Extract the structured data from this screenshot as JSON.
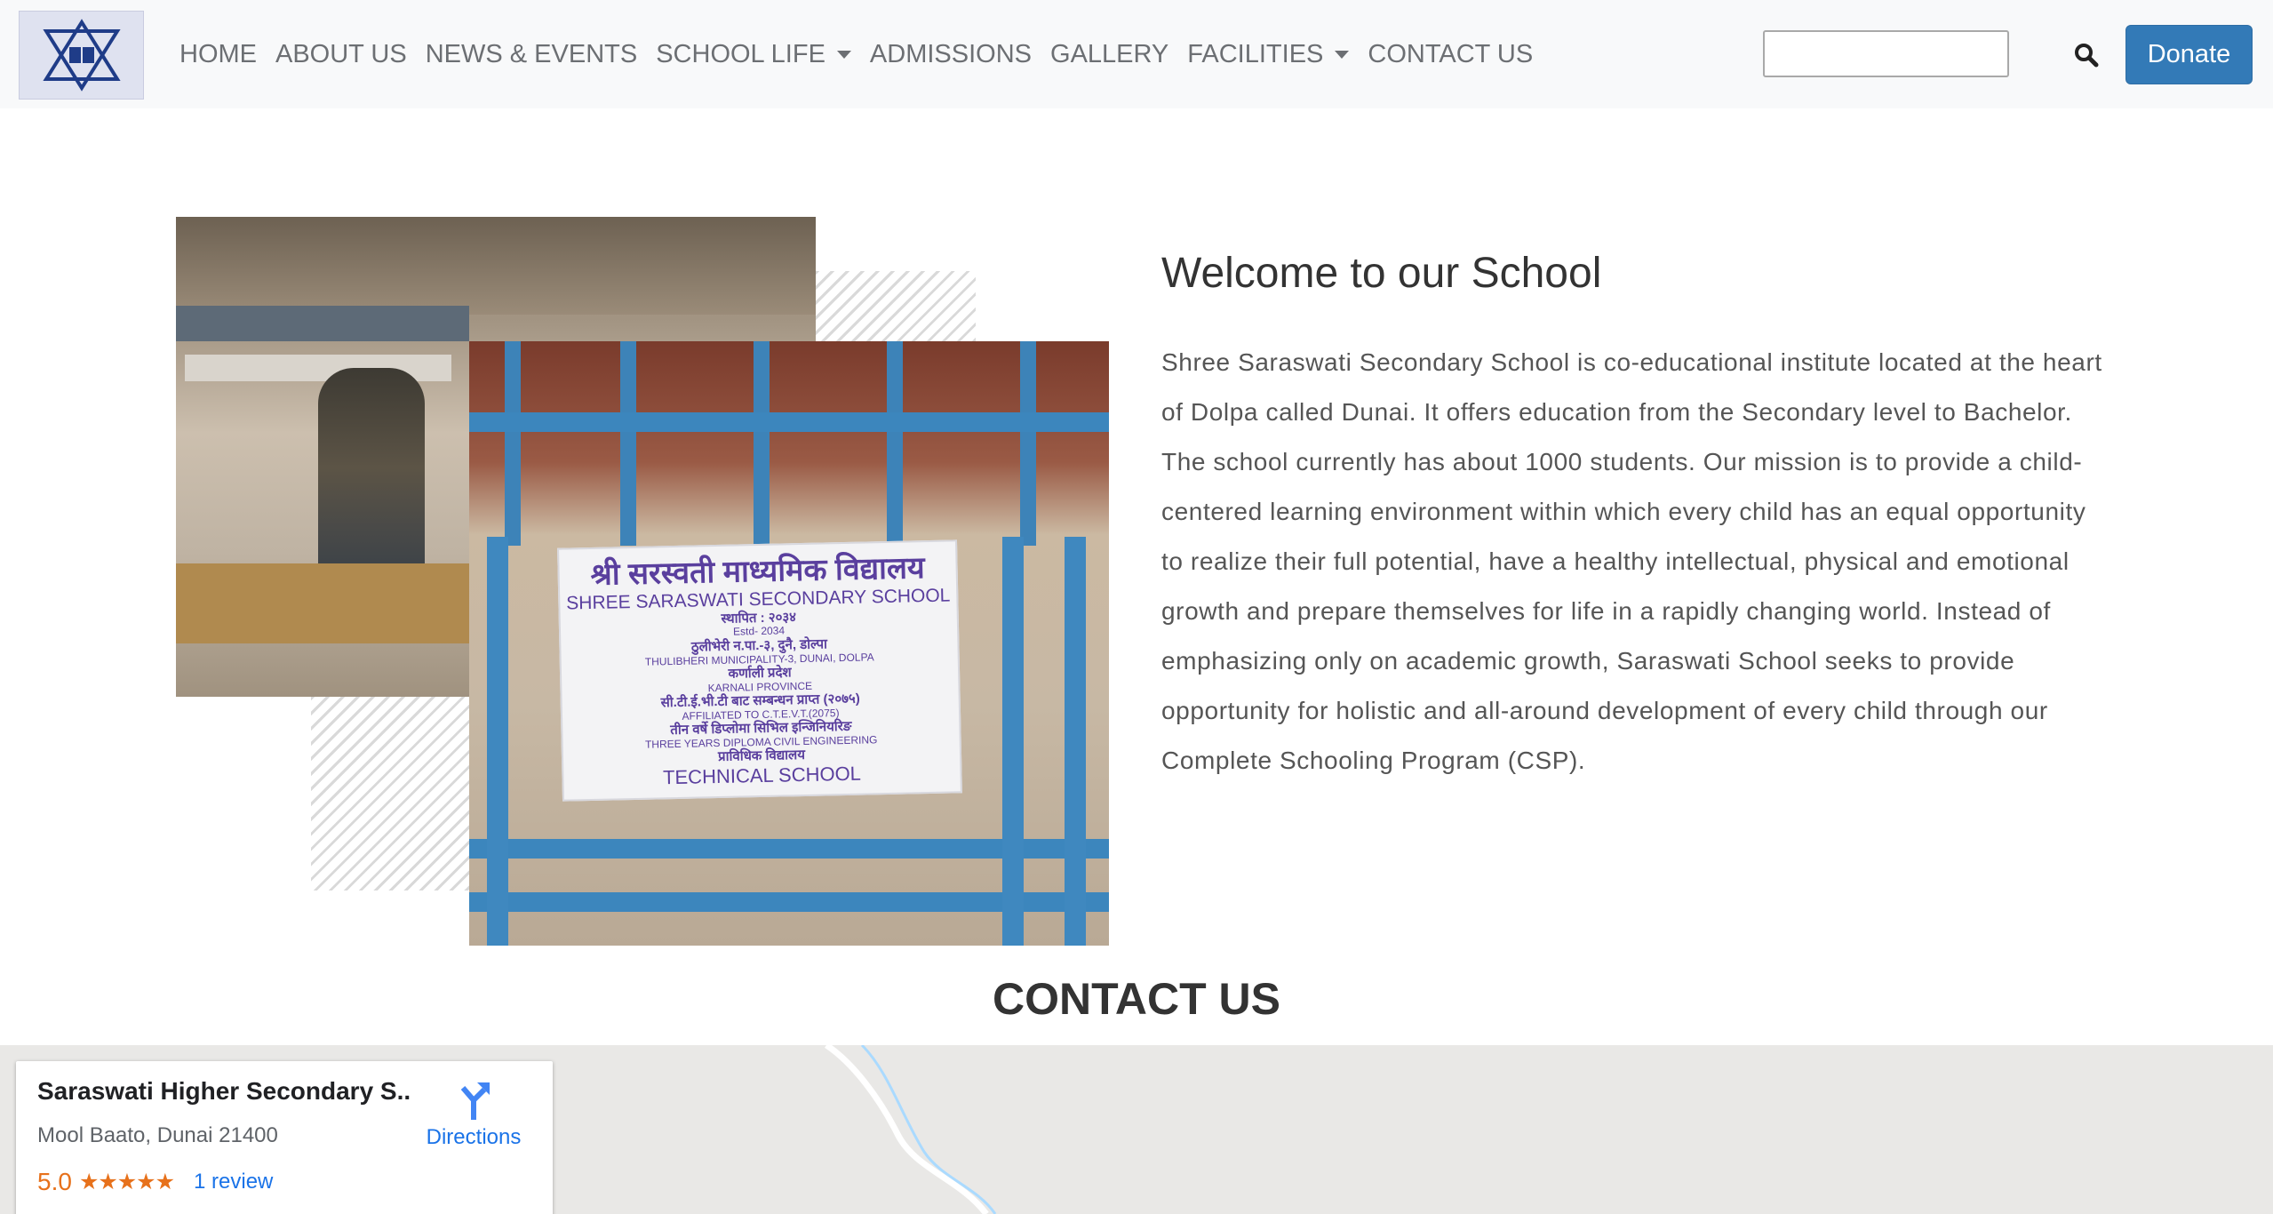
{
  "navbar": {
    "links": [
      {
        "label": "HOME"
      },
      {
        "label": "ABOUT US"
      },
      {
        "label": "NEWS & EVENTS"
      },
      {
        "label": "SCHOOL LIFE"
      },
      {
        "label": "ADMISSIONS"
      },
      {
        "label": "GALLERY"
      },
      {
        "label": "FACILITIES"
      },
      {
        "label": "CONTACT US"
      }
    ],
    "search": {
      "value": "",
      "placeholder": ""
    },
    "donate_label": "Donate"
  },
  "signboard": {
    "title_np": "श्री सरस्वती माध्यमिक विद्यालय",
    "title_en": "SHREE SARASWATI SECONDARY SCHOOL",
    "estd_np": "स्थापित : २०३४",
    "estd_en": "Estd- 2034",
    "location_np": "ठुलीभेरी न.पा.-३, दुनै, डोल्पा",
    "location_en": "THULIBHERI MUNICIPALITY-3, DUNAI, DOLPA",
    "province_np": "कर्णाली प्रदेश",
    "province_en": "KARNALI PROVINCE",
    "affiliation_np": "सी.टी.ई.भी.टी बाट सम्बन्धन प्राप्त (२०७५)",
    "affiliation_en": "AFFILIATED TO C.T.E.V.T.(2075)",
    "diploma_np": "तीन वर्षे डिप्लोमा सिभिल इन्जिनियरिङ",
    "diploma_en": "THREE YEARS DIPLOMA CIVIL ENGINEERING",
    "tech_np": "प्राविधिक विद्यालय",
    "tech_en": "TECHNICAL SCHOOL"
  },
  "welcome": {
    "title": "Welcome to our School",
    "text": "Shree Saraswati Secondary School is co-educational institute located at the heart of Dolpa called Dunai. It offers education from the Secondary level to Bachelor. The school currently has about 1000 students. Our mission is to provide a child-centered learning environment within which every child has an equal opportunity to realize their full potential, have a healthy intellectual, physical and emotional growth and prepare themselves for life in a rapidly changing world. Instead of emphasizing only on academic growth, Saraswati School seeks to provide opportunity for holistic and all-around development of every child through our Complete Schooling Program (CSP)."
  },
  "contact": {
    "heading": "CONTACT US"
  },
  "map": {
    "place_name": "Saraswati Higher Secondary S...",
    "address": "Mool Baato, Dunai 21400",
    "rating": "5.0",
    "stars": "★★★★★",
    "reviews_label": "1 review",
    "directions_label": "Directions"
  }
}
